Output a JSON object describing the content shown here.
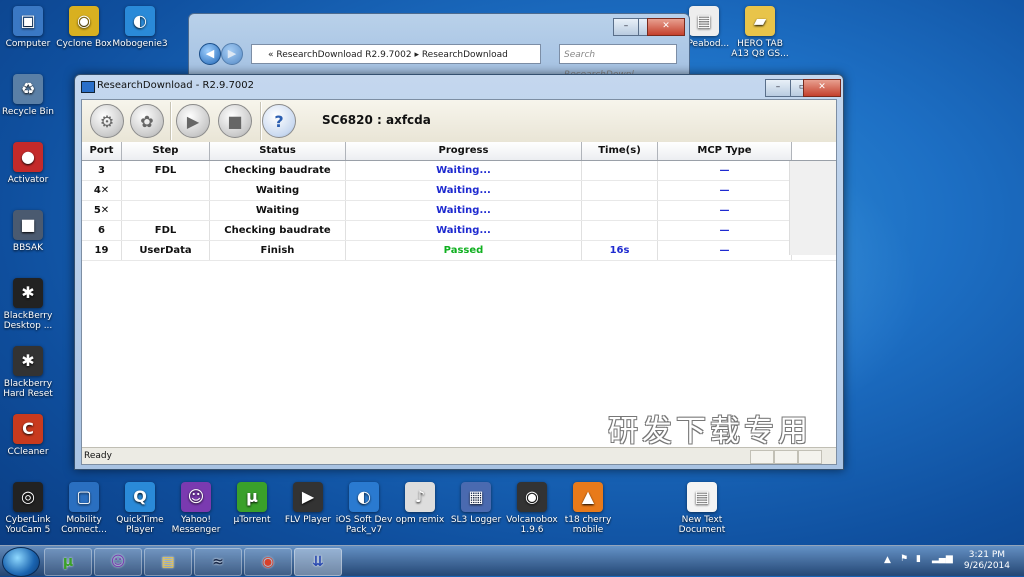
{
  "desktop": {
    "icons_left": [
      {
        "label": "Computer",
        "glyph": "▣",
        "color": "#3a78c4"
      },
      {
        "label": "Recycle Bin",
        "glyph": "♻",
        "color": "#5a7fa6"
      },
      {
        "label": "Activator",
        "glyph": "●",
        "color": "#c42a2a"
      },
      {
        "label": "BBSAK",
        "glyph": "■",
        "color": "#4a5a70"
      },
      {
        "label": "BlackBerry Desktop ...",
        "glyph": "✱",
        "color": "#222222"
      },
      {
        "label": "Blackberry Hard Reset",
        "glyph": "✱",
        "color": "#333333"
      },
      {
        "label": "CCleaner",
        "glyph": "C",
        "color": "#c83a1e"
      }
    ],
    "icons_col2": [
      {
        "label": "Cyclone Box",
        "glyph": "◉",
        "color": "#d8b020"
      },
      {
        "label": "Mobogenie3",
        "glyph": "◐",
        "color": "#2a8ad8"
      }
    ],
    "icons_right": [
      {
        "label": "...Peabod...",
        "glyph": "▤",
        "color": "#eeeeee"
      },
      {
        "label": "HERO TAB A13 Q8 GS...",
        "glyph": "▰",
        "color": "#e8c44a"
      }
    ],
    "icons_bottom": [
      {
        "label": "CyberLink YouCam 5",
        "glyph": "◎",
        "color": "#222222"
      },
      {
        "label": "Mobility Connect...",
        "glyph": "▢",
        "color": "#2a6fc0"
      },
      {
        "label": "QuickTime Player",
        "glyph": "Q",
        "color": "#2a8ad8"
      },
      {
        "label": "Yahoo! Messenger",
        "glyph": "☺",
        "color": "#7a3ab0"
      },
      {
        "label": "µTorrent",
        "glyph": "µ",
        "color": "#3aa02a"
      },
      {
        "label": "FLV Player",
        "glyph": "▶",
        "color": "#333333"
      },
      {
        "label": "iOS Soft Dev Pack_v7",
        "glyph": "◐",
        "color": "#2a7ad0"
      },
      {
        "label": "opm remix",
        "glyph": "♪",
        "color": "#dddddd"
      },
      {
        "label": "SL3 Logger",
        "glyph": "▦",
        "color": "#4a6ab0"
      },
      {
        "label": "Volcanobox 1.9.6",
        "glyph": "◉",
        "color": "#333333"
      },
      {
        "label": "t18 cherry mobile",
        "glyph": "▲",
        "color": "#e87a1a"
      },
      {
        "label": "New Text Document",
        "glyph": "▤",
        "color": "#f4f4f4"
      }
    ]
  },
  "explorer": {
    "address": "« ResearchDownload R2.9.7002 ▸ ResearchDownload",
    "search_placeholder": "Search ResearchDownl...",
    "min": "–",
    "max": "▭",
    "close": "✕"
  },
  "window": {
    "title": "ResearchDownload - R2.9.7002",
    "min": "–",
    "max": "▭",
    "close": "✕",
    "chip_label": "SC6820 : axfcda",
    "status_text": "Ready",
    "watermark": "研发下载专用"
  },
  "toolbar": {
    "buttons": [
      {
        "name": "settings-button",
        "icon": "gear-icon",
        "glyph": "⚙"
      },
      {
        "name": "load-packet-button",
        "icon": "gears-icon",
        "glyph": "✿"
      },
      {
        "name": "start-button",
        "icon": "play-icon",
        "glyph": "▶"
      },
      {
        "name": "stop-button",
        "icon": "stop-icon",
        "glyph": "■"
      },
      {
        "name": "help-button",
        "icon": "help-icon",
        "glyph": "?"
      }
    ]
  },
  "table": {
    "columns": [
      "Port",
      "Step",
      "Status",
      "Progress",
      "Time(s)",
      "MCP Type"
    ],
    "rows": [
      {
        "port": "3",
        "step": "FDL",
        "status": "Checking baudrate",
        "progress": "Waiting...",
        "time": "",
        "mcp": "—"
      },
      {
        "port": "4✕",
        "step": "",
        "status": "Waiting",
        "progress": "Waiting...",
        "time": "",
        "mcp": "—"
      },
      {
        "port": "5✕",
        "step": "",
        "status": "Waiting",
        "progress": "Waiting...",
        "time": "",
        "mcp": "—"
      },
      {
        "port": "6",
        "step": "FDL",
        "status": "Checking baudrate",
        "progress": "Waiting...",
        "time": "",
        "mcp": "—"
      },
      {
        "port": "19",
        "step": "UserData",
        "status": "Finish",
        "progress": "Passed",
        "time": "16s",
        "mcp": "—"
      }
    ]
  },
  "taskbar": {
    "buttons": [
      {
        "name": "taskbar-utorrent",
        "glyph": "µ",
        "color": "#3aa02a"
      },
      {
        "name": "taskbar-yahoo",
        "glyph": "☺",
        "color": "#7a3ab0"
      },
      {
        "name": "taskbar-explorer",
        "glyph": "▤",
        "color": "#e8c44a"
      },
      {
        "name": "taskbar-app",
        "glyph": "≈",
        "color": "#1a2a4a"
      },
      {
        "name": "taskbar-chrome",
        "glyph": "◉",
        "color": "#d8402a"
      },
      {
        "name": "taskbar-researchdownload",
        "glyph": "⇊",
        "color": "#2a4ab0"
      }
    ],
    "time": "3:21 PM",
    "date": "9/26/2014"
  }
}
